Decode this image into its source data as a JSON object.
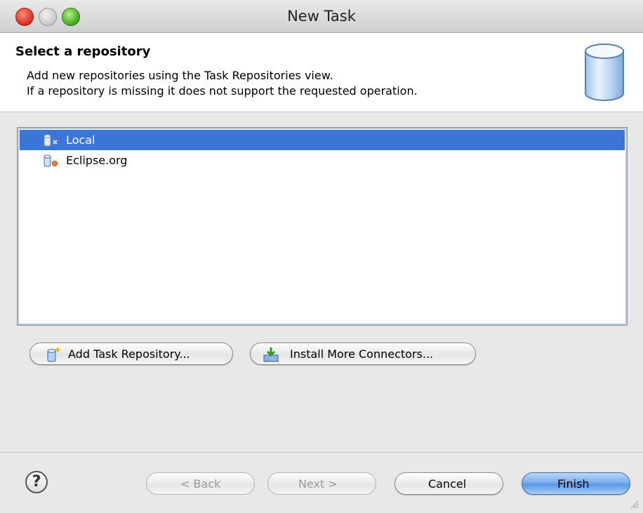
{
  "window": {
    "title": "New Task"
  },
  "header": {
    "title": "Select a repository",
    "line1": "Add new repositories using the Task Repositories view.",
    "line2": "If a repository is missing it does not support the requested operation.",
    "icon": "repository-banner-icon"
  },
  "repositories": [
    {
      "label": "Local",
      "icon": "local-repository-icon",
      "selected": true
    },
    {
      "label": "Eclipse.org",
      "icon": "bugzilla-repository-icon",
      "selected": false
    }
  ],
  "actions": {
    "add_repository": "Add Task Repository...",
    "install_connectors": "Install More Connectors..."
  },
  "footer": {
    "help": "?",
    "back": "< Back",
    "next": "Next >",
    "cancel": "Cancel",
    "finish": "Finish"
  },
  "colors": {
    "selection": "#3b76d6",
    "default_button": "#5394e6"
  }
}
